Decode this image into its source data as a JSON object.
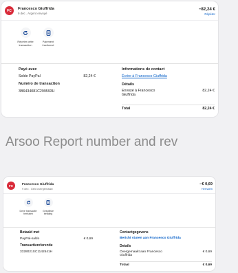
{
  "card1": {
    "avatar": "FC",
    "name": "Francesco Giuffrida",
    "subtitle": "9 déc . Argent envoyé",
    "amount": "−82,24 €",
    "header_link": "Répéter",
    "actions": [
      {
        "icon": "repeat-icon",
        "label": "Répéter cette transaction"
      },
      {
        "icon": "split-icon",
        "label": "Paiement fractionné"
      }
    ],
    "paid_with": {
      "heading": "Payé avec",
      "label": "Solde PayPal",
      "value": "82,24 €"
    },
    "transaction": {
      "heading": "Numéro de transaction",
      "value": "3B6434081C299593U"
    },
    "contact": {
      "heading": "Informations de contact",
      "link": "Écrire à Francesco Giuffrida"
    },
    "details": {
      "heading": "Détails",
      "label": "Envoyé à Francesco Giuffrida",
      "value": "82,24 €",
      "total_label": "Total",
      "total_value": "82,24 €"
    }
  },
  "overlay_text": "Arsoo   Report number and rev",
  "card2": {
    "avatar": "FC",
    "name": "Francesco Giuffrida",
    "subtitle": "9 dec . Geld overgemaakt",
    "amount": "−€ 0,69",
    "header_link": "Herhalen",
    "actions": [
      {
        "icon": "repeat-icon",
        "label": "Deze transactie herhalen"
      },
      {
        "icon": "split-icon",
        "label": "Gesplitste betaling"
      }
    ],
    "paid_with": {
      "heading": "Betaald met",
      "label": "PayPal-saldo",
      "value": "€ 0,69"
    },
    "transaction": {
      "heading": "Transactiereferentie",
      "value": "3328021SC1142541H"
    },
    "contact": {
      "heading": "Contactgegevens",
      "link": "Bericht sturen aan Francesco Giuffrida"
    },
    "details": {
      "heading": "Details",
      "label": "Overgemaakt aan Francesco Giuffrida",
      "value": "€ 0,69",
      "total_label": "Totaal",
      "total_value": "€ 0,69"
    }
  }
}
